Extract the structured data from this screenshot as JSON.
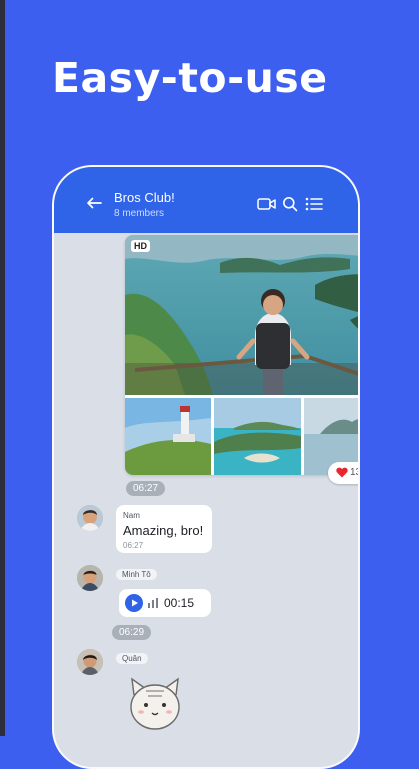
{
  "promo": {
    "title": "Easy-to-use"
  },
  "chat": {
    "name": "Bros Club!",
    "members": "8 members",
    "photo_badge": "HD",
    "reactions": {
      "count": "13"
    },
    "messages": [
      {
        "time_chip": "06:27"
      },
      {
        "sender": "Nam",
        "text": "Amazing, bro!",
        "time": "06:27"
      },
      {
        "sender": "Minh Tô",
        "duration": "00:15"
      },
      {
        "time_chip": "06:29"
      },
      {
        "sender": "Quân"
      }
    ]
  },
  "icons": [
    "back-arrow-icon",
    "video-call-icon",
    "search-icon",
    "list-icon",
    "heart-icon",
    "play-icon",
    "audio-wave-icon"
  ],
  "colors": {
    "background": "#3d5ff0",
    "header": "#2f63e8",
    "chat_bg": "#d9dee7",
    "heart": "#e8262f"
  }
}
